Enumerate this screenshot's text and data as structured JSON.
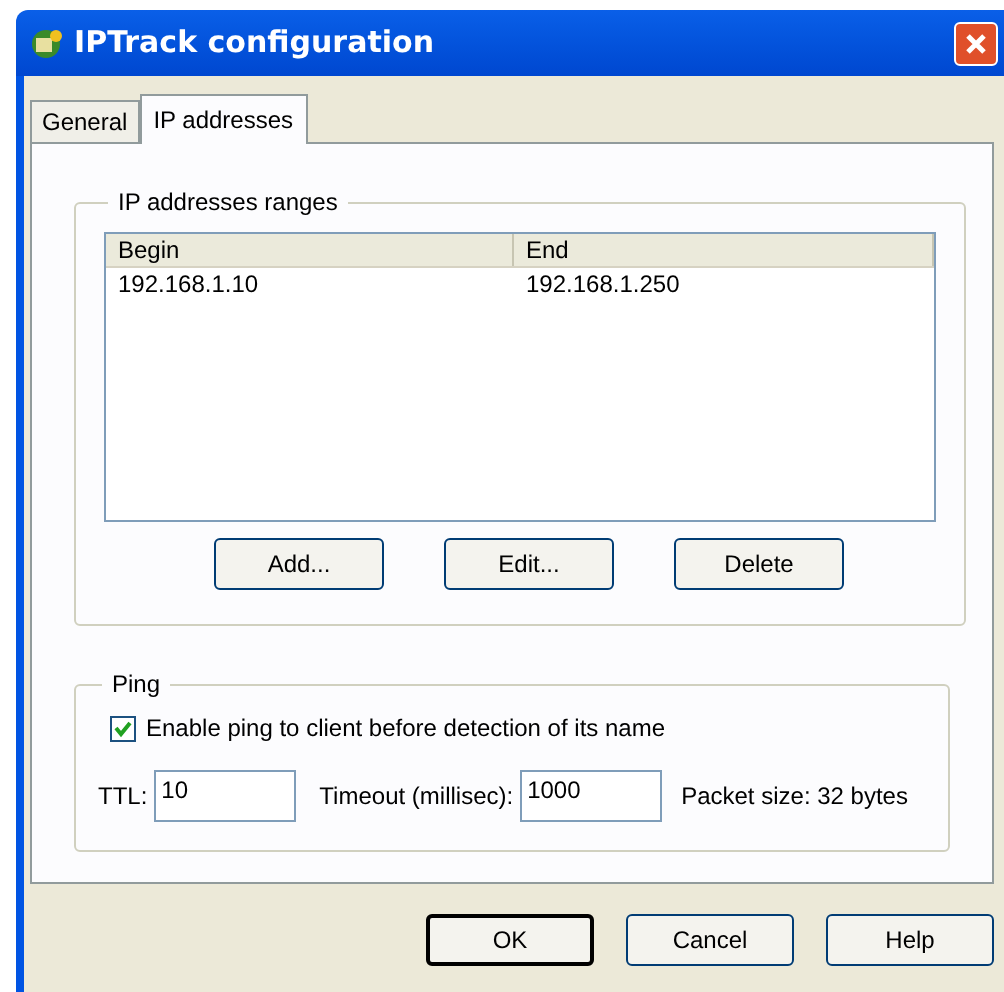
{
  "window": {
    "title": "IPTrack configuration"
  },
  "tabs": [
    {
      "label": "General",
      "selected": false
    },
    {
      "label": "IP addresses",
      "selected": true
    }
  ],
  "ranges": {
    "title": "IP addresses ranges",
    "columns": [
      "Begin",
      "End"
    ],
    "rows": [
      [
        "192.168.1.10",
        "192.168.1.250"
      ]
    ],
    "buttons": [
      "Add...",
      "Edit...",
      "Delete"
    ]
  },
  "ping": {
    "title": "Ping",
    "enable": {
      "label": "Enable ping to client before detection of its name",
      "checked": true
    },
    "ttl": {
      "label": "TTL:",
      "value": "10"
    },
    "timeout": {
      "label": "Timeout (millisec):",
      "value": "1000"
    },
    "packet_size": "Packet size: 32 bytes"
  },
  "buttons": [
    {
      "label": "OK",
      "default": true
    },
    {
      "label": "Cancel",
      "default": false
    },
    {
      "label": "Help",
      "default": false
    }
  ]
}
